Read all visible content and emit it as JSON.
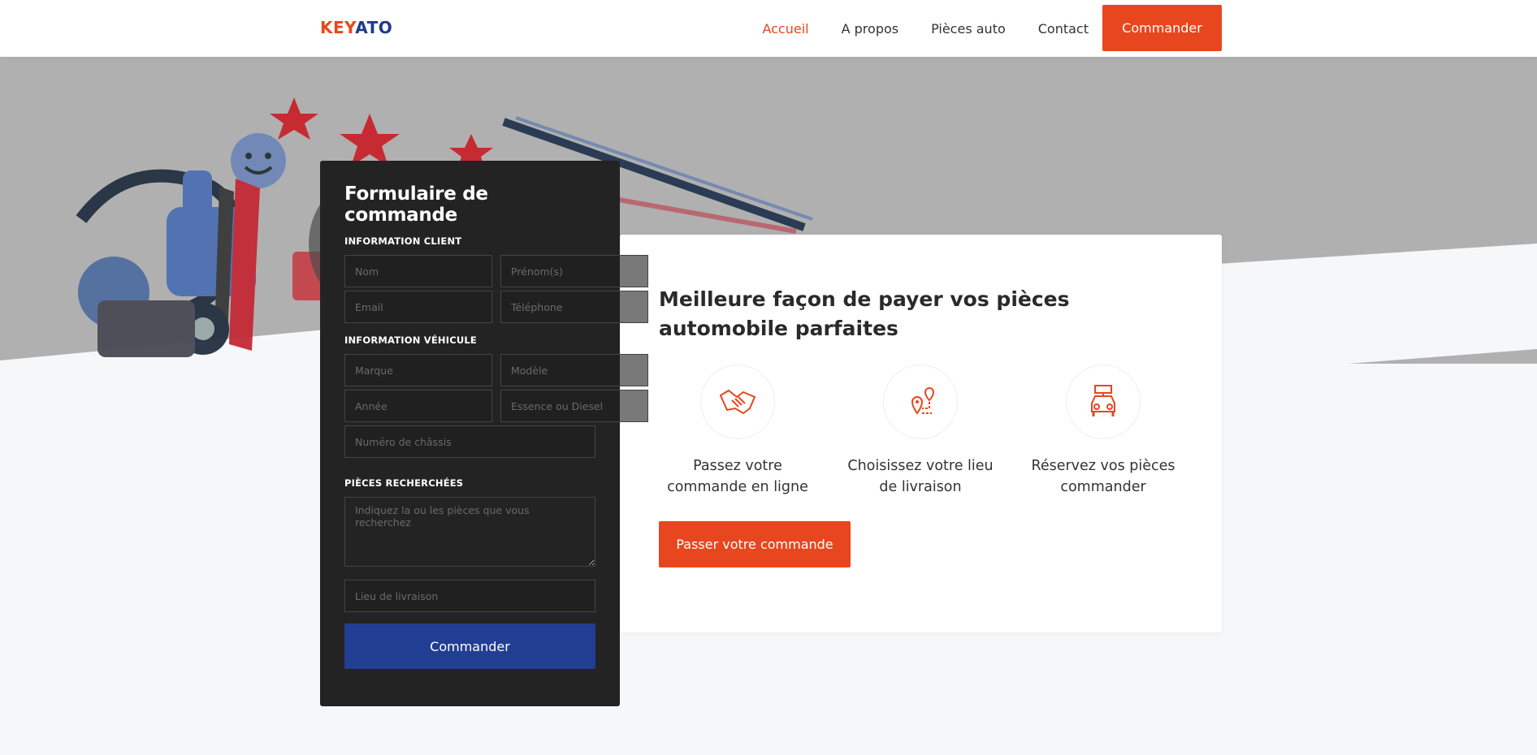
{
  "brand": {
    "part1": "KEY",
    "part2": "ATO"
  },
  "nav": {
    "items": [
      {
        "label": "Accueil",
        "active": true
      },
      {
        "label": "A propos",
        "active": false
      },
      {
        "label": "Pièces auto",
        "active": false
      },
      {
        "label": "Contact",
        "active": false
      }
    ],
    "cta_label": "Commander"
  },
  "form": {
    "title": "Formulaire de commande",
    "client_section": "INFORMATION CLIENT",
    "vehicle_section": "INFORMATION VÉHICULE",
    "parts_section": "PIÈCES RECHERCHÉES",
    "placeholders": {
      "nom": "Nom",
      "prenom": "Prénom(s)",
      "email": "Email",
      "telephone": "Téléphone",
      "marque": "Marque",
      "modele": "Modèle",
      "annee": "Année",
      "carburant": "Essence ou Diesel",
      "chassis": "Numéro de châssis",
      "pieces": "Indiquez la ou les pièces que vous recherchez",
      "livraison": "Lieu de livraison"
    },
    "submit_label": "Commander"
  },
  "info": {
    "title": "Meilleure façon de payer vos pièces automobile parfaites",
    "features": [
      {
        "icon": "handshake-icon",
        "label": "Passez votre commande en ligne"
      },
      {
        "icon": "route-location-icon",
        "label": "Choisissez votre lieu de livraison"
      },
      {
        "icon": "rent-car-icon",
        "label": "Réservez vos pièces commander"
      }
    ],
    "cta_label": "Passer votre commande"
  },
  "colors": {
    "accent": "#e8461e",
    "brand_blue": "#1f3a8a",
    "form_bg": "#232323",
    "submit_blue": "#223e92",
    "hero_gray": "#b0b0b0"
  }
}
